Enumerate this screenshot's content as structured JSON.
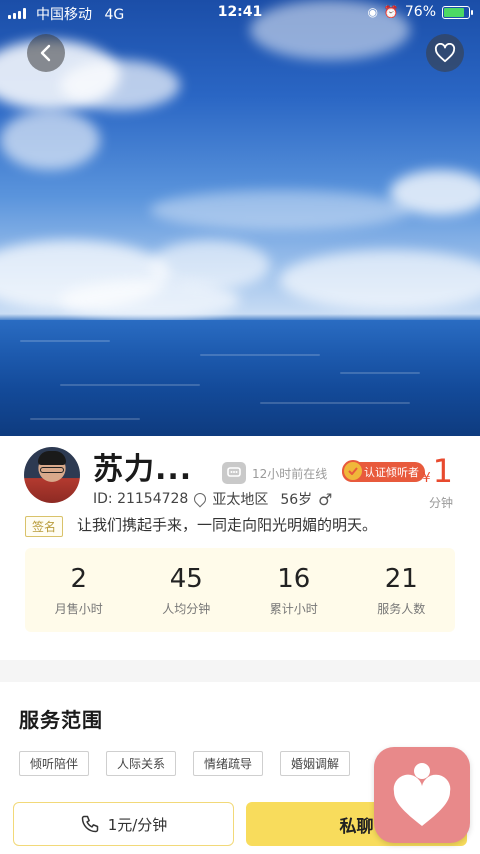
{
  "status_bar": {
    "carrier": "中国移动",
    "network": "4G",
    "time": "12:41",
    "battery_percent": "76%",
    "battery_level": 0.76
  },
  "profile": {
    "name": "苏力...",
    "online_status": "12小时前在线",
    "verified_label": "认证倾听者",
    "price_symbol": "¥",
    "price": "1",
    "price_unit": "分钟",
    "id_text": "ID: 21154728",
    "region": "亚太地区",
    "age": "56岁",
    "gender_symbol": "♂",
    "signature_tag": "签名",
    "signature": "让我们携起手来，一同走向阳光明媚的明天。"
  },
  "stats": [
    {
      "value": "2",
      "label": "月售小时"
    },
    {
      "value": "45",
      "label": "人均分钟"
    },
    {
      "value": "16",
      "label": "累计小时"
    },
    {
      "value": "21",
      "label": "服务人数"
    }
  ],
  "services": {
    "title": "服务范围",
    "tags": [
      "倾听陪伴",
      "人际关系",
      "情绪疏导",
      "婚姻调解"
    ]
  },
  "actions": {
    "call_label": "1元/分钟",
    "message_label": "私聊"
  },
  "colors": {
    "accent_red": "#e84a2e",
    "accent_yellow": "#f8dc5c",
    "logo_pink": "#e8898a"
  }
}
